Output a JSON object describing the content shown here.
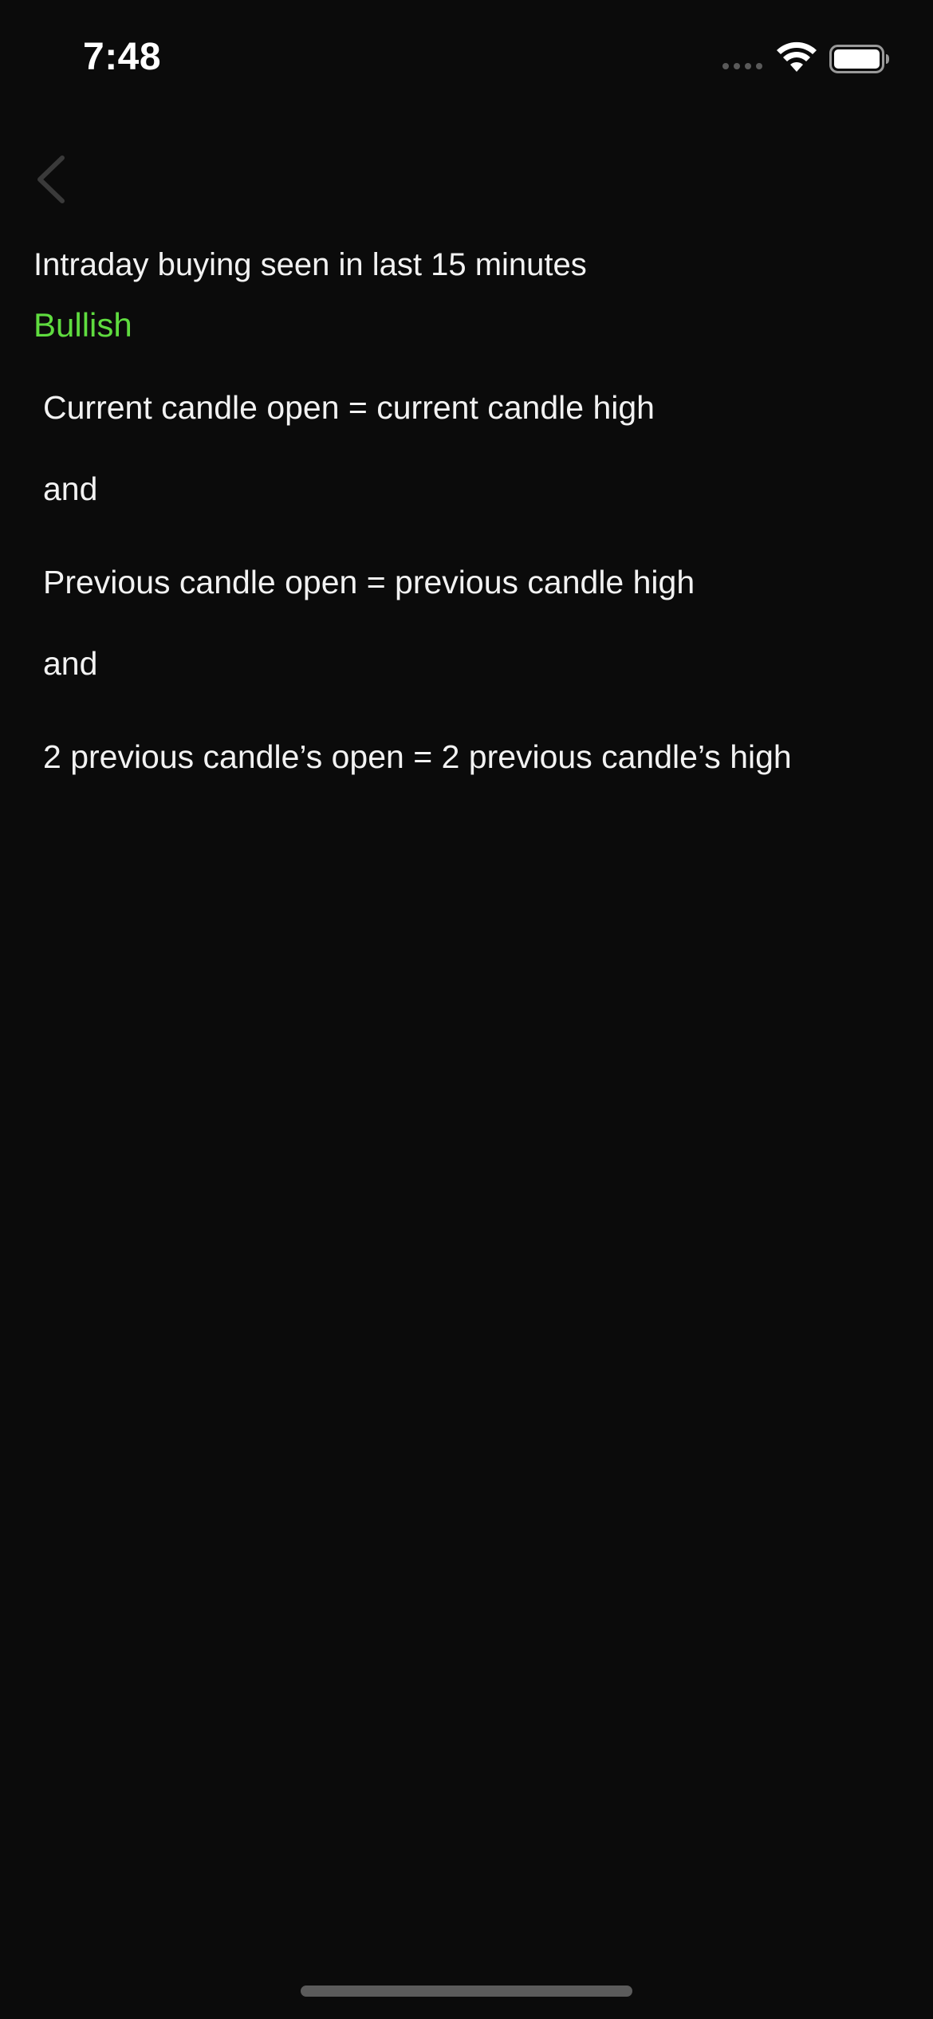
{
  "status_bar": {
    "time": "7:48",
    "signal_icon": "cellular-dots-icon",
    "wifi_icon": "wifi-icon",
    "battery_icon": "battery-icon"
  },
  "nav": {
    "back_icon": "chevron-left-icon"
  },
  "screener": {
    "title": "Intraday buying seen in last 15 minutes",
    "sentiment": "Bullish",
    "sentiment_color": "#5fdc3f",
    "conditions": [
      "Current candle open = current candle high",
      "and",
      "Previous candle open = previous candle high",
      "and",
      "2 previous candle’s open = 2 previous candle’s high"
    ]
  },
  "colors": {
    "background": "#0b0b0b",
    "text": "#f2f2f2",
    "accent_green": "#5fdc3f"
  }
}
